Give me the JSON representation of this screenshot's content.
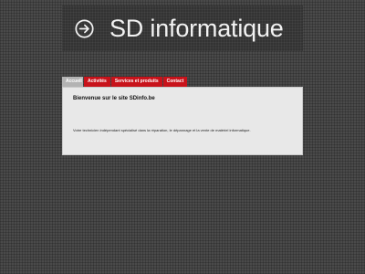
{
  "header": {
    "title": "SD informatique",
    "logo_icon": "arrow-right-circle-icon"
  },
  "nav": {
    "tabs": [
      {
        "label": "Accueil",
        "active": true
      },
      {
        "label": "Activités",
        "active": false
      },
      {
        "label": "Services et produits",
        "active": false
      },
      {
        "label": "Contact",
        "active": false
      }
    ]
  },
  "main": {
    "heading": "Bienvenue sur le site SDinfo.be",
    "body": "Votre technicien indépendant spécialisé dans la réparation, le dépannage et la vente de matériel informatique."
  },
  "colors": {
    "page_bg": "#4a4a4a",
    "banner_bg": "#333333",
    "tab_red": "#c8131b",
    "tab_active": "#b3b3b3",
    "content_bg": "#e8e8e8"
  }
}
